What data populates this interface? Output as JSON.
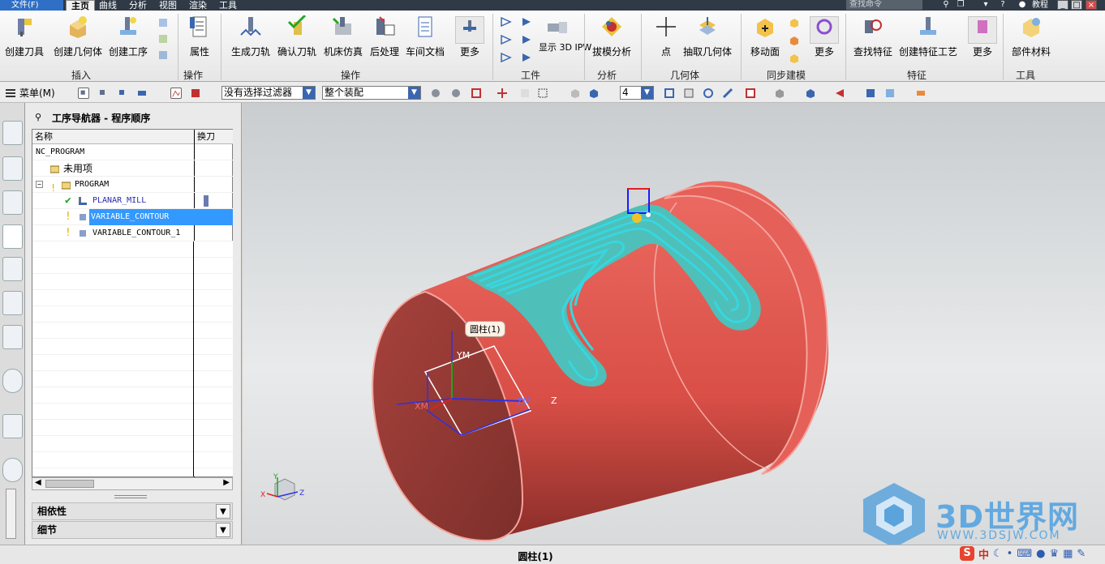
{
  "titlebar": {
    "file_menu": "文件(F)",
    "tabs": [
      "主页",
      "曲线",
      "分析",
      "视图",
      "渲染",
      "工具"
    ],
    "search_placeholder": "查找命令",
    "user": "教程"
  },
  "ribbon": {
    "buttons": [
      "创建刀具",
      "创建几何体",
      "创建工序",
      "属性",
      "生成刀轨",
      "确认刀轨",
      "机床仿真",
      "后处理",
      "车间文档",
      "更多",
      "显示 3D IPW",
      "拔模分析",
      "点",
      "抽取几何体",
      "移动面",
      "更多",
      "查找特征",
      "创建特征工艺",
      "更多",
      "部件材料"
    ],
    "groups": [
      "插入",
      "操作",
      "操作",
      "工件",
      "分析",
      "几何体",
      "同步建模",
      "特征",
      "工具"
    ]
  },
  "toolbar2": {
    "menu_label": "菜单(M)",
    "filter": "没有选择过滤器",
    "assembly": "整个装配",
    "layer_value": "4"
  },
  "navigator": {
    "title": "工序导航器 - 程序顺序",
    "columns": [
      "名称",
      "换刀"
    ],
    "rows": [
      {
        "label": "NC_PROGRAM",
        "indent": 0
      },
      {
        "label": "未用项",
        "indent": 1
      },
      {
        "label": "PROGRAM",
        "indent": 1
      },
      {
        "label": "PLANAR_MILL",
        "indent": 2
      },
      {
        "label": "VARIABLE_CONTOUR",
        "indent": 2
      },
      {
        "label": "VARIABLE_CONTOUR_1",
        "indent": 2
      }
    ],
    "accordion": [
      "相依性",
      "细节"
    ]
  },
  "viewport": {
    "tooltip": "圆柱(1)",
    "axis_labels": {
      "ym": "YM",
      "xm": "XM",
      "zm": "ZM",
      "z": "Z",
      "x": "X",
      "y": "Y"
    }
  },
  "status": {
    "text": "圆柱(1)"
  },
  "watermark": {
    "brand": "3D世界网",
    "url": "WWW.3DSJW.COM"
  },
  "ime": {
    "label": "中"
  },
  "colors": {
    "part": "#e25b54",
    "toolpath": "#36d7e0",
    "accent": "#2f6fc6"
  }
}
